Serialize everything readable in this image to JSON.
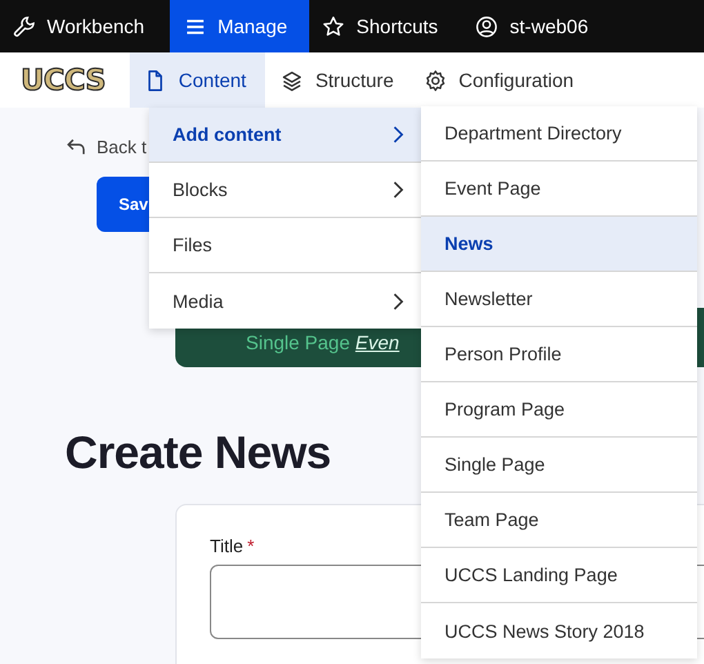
{
  "toolbar": [
    {
      "label": "Workbench",
      "selected": false
    },
    {
      "label": "Manage",
      "selected": true
    },
    {
      "label": "Shortcuts",
      "selected": false
    },
    {
      "label": "st-web06",
      "selected": false
    }
  ],
  "logo": "UCCS",
  "admin_menu": [
    {
      "label": "Content",
      "selected": true
    },
    {
      "label": "Structure",
      "selected": false
    },
    {
      "label": "Configuration",
      "selected": false
    }
  ],
  "content_menu": [
    {
      "label": "Add content",
      "selected": true,
      "has_submenu": true
    },
    {
      "label": "Blocks",
      "selected": false,
      "has_submenu": true
    },
    {
      "label": "Files",
      "selected": false,
      "has_submenu": false
    },
    {
      "label": "Media",
      "selected": false,
      "has_submenu": true
    }
  ],
  "add_content_menu": [
    {
      "label": "Department Directory",
      "selected": false
    },
    {
      "label": "Event Page",
      "selected": false
    },
    {
      "label": "News",
      "selected": true
    },
    {
      "label": "Newsletter",
      "selected": false
    },
    {
      "label": "Person Profile",
      "selected": false
    },
    {
      "label": "Program Page",
      "selected": false
    },
    {
      "label": "Single Page",
      "selected": false
    },
    {
      "label": "Team Page",
      "selected": false
    },
    {
      "label": "UCCS Landing Page",
      "selected": false
    },
    {
      "label": "UCCS News Story 2018",
      "selected": false
    }
  ],
  "page": {
    "back_link": "Back t",
    "save_button": "Sav",
    "banner": {
      "text": "Single Page ",
      "link": "Even"
    },
    "heading": "Create News",
    "form": {
      "title_label": "Title",
      "required_mark": "*"
    }
  }
}
